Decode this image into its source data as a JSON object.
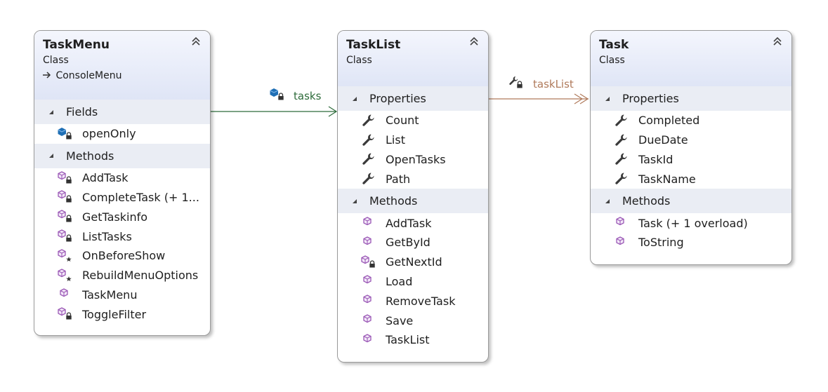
{
  "classes": {
    "taskmenu": {
      "name": "TaskMenu",
      "kind": "Class",
      "base": "ConsoleMenu",
      "fields_label": "Fields",
      "methods_label": "Methods",
      "fields": [
        {
          "label": "openOnly",
          "icon": "field-private-icon"
        }
      ],
      "methods": [
        {
          "label": "AddTask",
          "icon": "method-private-icon"
        },
        {
          "label": "CompleteTask  (+ 1...",
          "icon": "method-private-icon"
        },
        {
          "label": "GetTaskinfo",
          "icon": "method-private-icon"
        },
        {
          "label": "ListTasks",
          "icon": "method-private-icon"
        },
        {
          "label": "OnBeforeShow",
          "icon": "method-protected-icon"
        },
        {
          "label": "RebuildMenuOptions",
          "icon": "method-protected-icon"
        },
        {
          "label": "TaskMenu",
          "icon": "method-public-icon"
        },
        {
          "label": "ToggleFilter",
          "icon": "method-private-icon"
        }
      ]
    },
    "tasklist": {
      "name": "TaskList",
      "kind": "Class",
      "properties_label": "Properties",
      "methods_label": "Methods",
      "properties": [
        {
          "label": "Count",
          "icon": "wrench-icon"
        },
        {
          "label": "List",
          "icon": "wrench-icon"
        },
        {
          "label": "OpenTasks",
          "icon": "wrench-icon"
        },
        {
          "label": "Path",
          "icon": "wrench-icon"
        }
      ],
      "methods": [
        {
          "label": "AddTask",
          "icon": "method-public-icon"
        },
        {
          "label": "GetById",
          "icon": "method-public-icon"
        },
        {
          "label": "GetNextId",
          "icon": "method-private-icon"
        },
        {
          "label": "Load",
          "icon": "method-public-icon"
        },
        {
          "label": "RemoveTask",
          "icon": "method-public-icon"
        },
        {
          "label": "Save",
          "icon": "method-public-icon"
        },
        {
          "label": "TaskList",
          "icon": "method-public-icon"
        }
      ]
    },
    "task": {
      "name": "Task",
      "kind": "Class",
      "properties_label": "Properties",
      "methods_label": "Methods",
      "properties": [
        {
          "label": "Completed",
          "icon": "wrench-icon"
        },
        {
          "label": "DueDate",
          "icon": "wrench-icon"
        },
        {
          "label": "TaskId",
          "icon": "wrench-icon"
        },
        {
          "label": "TaskName",
          "icon": "wrench-icon"
        }
      ],
      "methods": [
        {
          "label": "Task (+ 1 overload)",
          "icon": "method-public-icon"
        },
        {
          "label": "ToString",
          "icon": "method-public-icon"
        }
      ]
    }
  },
  "associations": {
    "tasks": {
      "label": "tasks",
      "from": "TaskMenu",
      "to": "TaskList",
      "color": "#2d6b3a"
    },
    "taskList": {
      "label": "taskList",
      "from": "TaskList",
      "to": "Task",
      "color": "#b07a5b"
    }
  },
  "colors": {
    "header_top": "#f4f6fd",
    "header_bottom": "#dfe5f6",
    "section_bg": "#eaedf4",
    "method_icon": "#9b59b6",
    "field_icon": "#1f6fb5"
  }
}
